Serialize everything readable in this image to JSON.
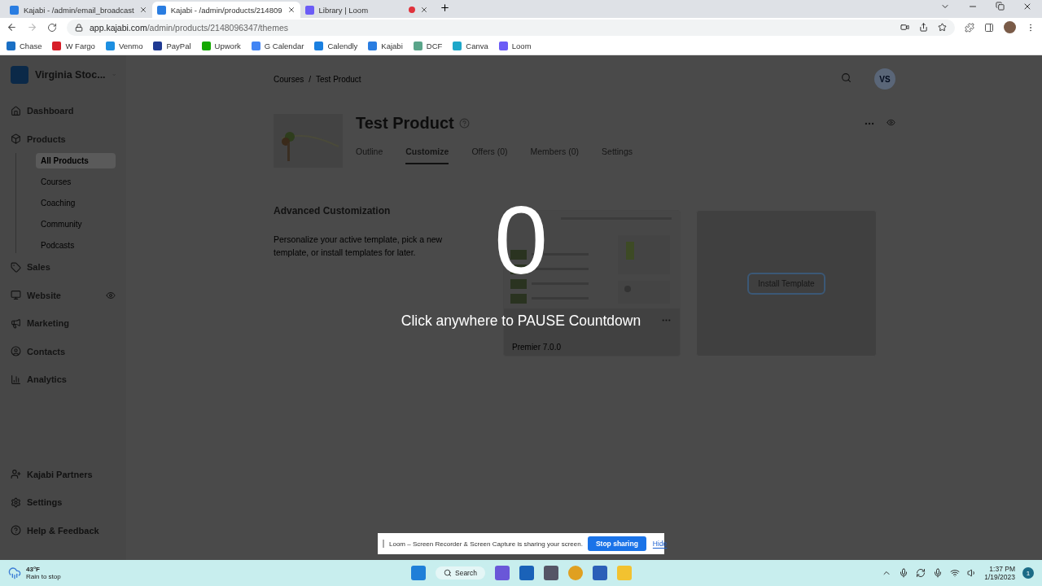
{
  "browser": {
    "tabs": [
      {
        "title": "Kajabi - /admin/email_broadcast",
        "selected": false,
        "recording": false
      },
      {
        "title": "Kajabi - /admin/products/214809",
        "selected": true,
        "recording": false
      },
      {
        "title": "Library | Loom",
        "selected": false,
        "recording": true
      }
    ],
    "url_host": "app.kajabi.com",
    "url_path": "/admin/products/2148096347/themes",
    "bookmarks": [
      {
        "label": "Chase",
        "color": "#1a6fc4"
      },
      {
        "label": "W Fargo",
        "color": "#d71e28"
      },
      {
        "label": "Venmo",
        "color": "#1d8fe1"
      },
      {
        "label": "PayPal",
        "color": "#1f3a93"
      },
      {
        "label": "Upwork",
        "color": "#14a800"
      },
      {
        "label": "G Calendar",
        "color": "#4285f4"
      },
      {
        "label": "Calendly",
        "color": "#1a7fe0"
      },
      {
        "label": "Kajabi",
        "color": "#2a7de1"
      },
      {
        "label": "DCF",
        "color": "#5aa58a"
      },
      {
        "label": "Canva",
        "color": "#1ea7c9"
      },
      {
        "label": "Loom",
        "color": "#6b5cf6"
      }
    ]
  },
  "sidebar": {
    "workspace": "Virginia Stoc...",
    "items": [
      {
        "label": "Dashboard",
        "selected": false
      },
      {
        "label": "Products",
        "selected": false,
        "children": [
          {
            "label": "All Products",
            "selected": true
          },
          {
            "label": "Courses",
            "selected": false
          },
          {
            "label": "Coaching",
            "selected": false
          },
          {
            "label": "Community",
            "selected": false
          },
          {
            "label": "Podcasts",
            "selected": false
          }
        ]
      },
      {
        "label": "Sales",
        "selected": false
      },
      {
        "label": "Website",
        "selected": false
      },
      {
        "label": "Marketing",
        "selected": false
      },
      {
        "label": "Contacts",
        "selected": false
      },
      {
        "label": "Analytics",
        "selected": false
      }
    ],
    "footer_items": [
      {
        "label": "Kajabi Partners"
      },
      {
        "label": "Settings"
      },
      {
        "label": "Help & Feedback"
      }
    ]
  },
  "header": {
    "breadcrumb": [
      "Courses",
      "Test Product"
    ],
    "breadcrumb_separator": "/",
    "avatar": "VS"
  },
  "product": {
    "title": "Test Product",
    "tabs": [
      {
        "label": "Outline",
        "selected": false
      },
      {
        "label": "Customize",
        "selected": true
      },
      {
        "label": "Offers (0)",
        "selected": false
      },
      {
        "label": "Members (0)",
        "selected": false
      },
      {
        "label": "Settings",
        "selected": false
      }
    ]
  },
  "section": {
    "heading": "Advanced Customization",
    "description": "Personalize your active template, pick a new template, or install templates for later.",
    "template_version": "Premier 7.0.0",
    "install_button": "Install Template"
  },
  "countdown": {
    "number": "0",
    "hint": "Click anywhere to PAUSE Countdown"
  },
  "share_bar": {
    "message": "Loom – Screen Recorder & Screen Capture is sharing your screen.",
    "stop_button": "Stop sharing",
    "hide_link": "Hide"
  },
  "taskbar": {
    "temperature": "43°F",
    "weather": "Rain to stop",
    "search": "Search",
    "time": "1:37 PM",
    "date": "1/19/2023",
    "notifications": "1"
  }
}
